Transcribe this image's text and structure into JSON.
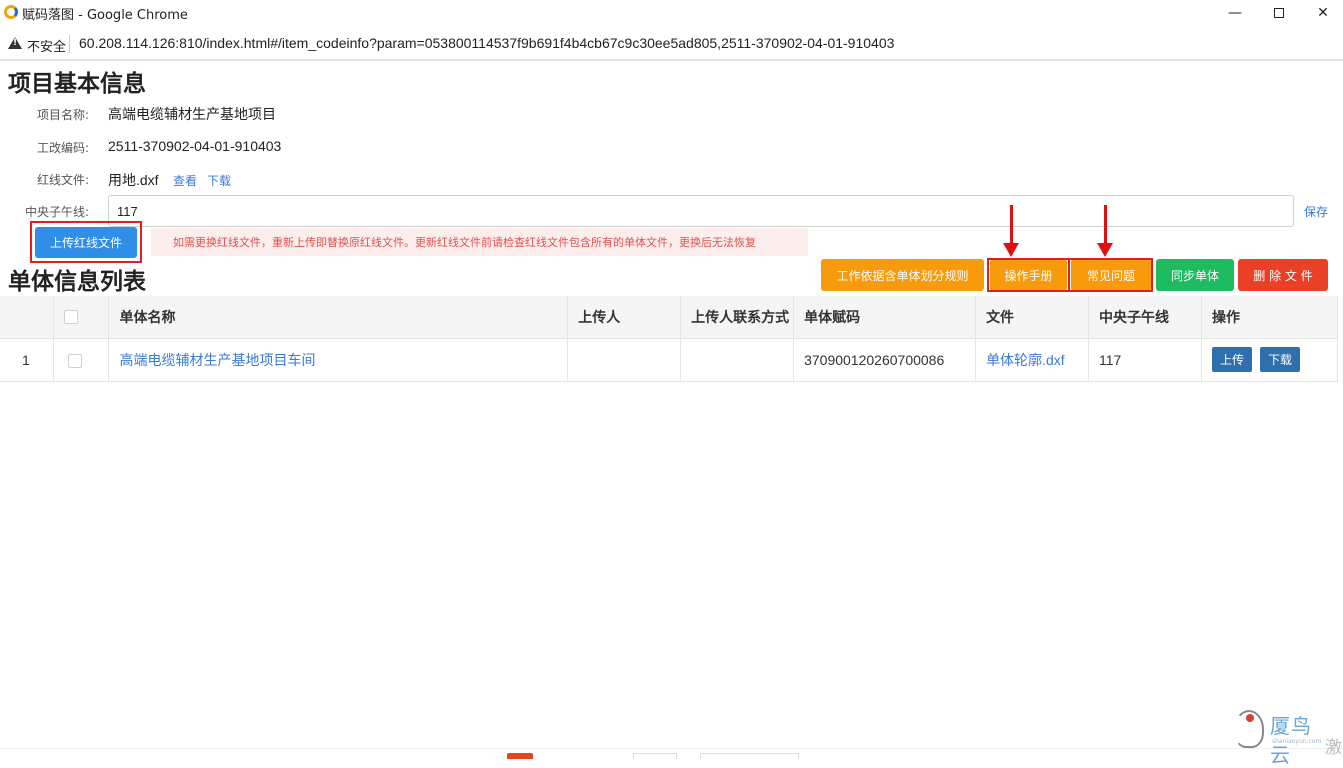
{
  "window": {
    "title": "赋码落图 - Google Chrome",
    "minimize": "—",
    "close": "✕"
  },
  "address": {
    "security": "不安全",
    "url": "60.208.114.126:810/index.html#/item_codeinfo?param=053800114537f9b691f4b4cb67c9c30ee5ad805,2511-370902-04-01-910403"
  },
  "project": {
    "heading": "项目基本信息",
    "name_label": "项目名称:",
    "name_value": "高端电缆辅材生产基地项目",
    "code_label": "工改编码:",
    "code_value": "2511-370902-04-01-910403",
    "redline_label": "红线文件:",
    "redline_file": "用地.dxf",
    "view_link": "查看",
    "download_link": "下载",
    "meridian_label": "中央子午线:",
    "meridian_value": "117",
    "save_link": "保存",
    "upload_button": "上传红线文件",
    "notice": "如需更换红线文件，重新上传即替换原红线文件。更新红线文件前请检查红线文件包含所有的单体文件，更换后无法恢复"
  },
  "units": {
    "heading": "单体信息列表",
    "buttons": {
      "rules": "工作依据含单体划分规则",
      "manual": "操作手册",
      "faq": "常见问题",
      "sync": "同步单体",
      "delete": "删 除 文 件"
    },
    "columns": [
      "",
      "",
      "单体名称",
      "上传人",
      "上传人联系方式",
      "单体赋码",
      "文件",
      "中央子午线",
      "操作"
    ],
    "rows": [
      {
        "index": "1",
        "name": "高端电缆辅材生产基地项目车间",
        "uploader": "",
        "contact": "",
        "code": "370900120260700086",
        "file": "单体轮廓.dxf",
        "meridian": "117",
        "upload": "上传",
        "download": "下载"
      }
    ]
  },
  "watermark": {
    "brand": "厦鸟云",
    "domain": "shaniaoyun.com",
    "edge": "激"
  },
  "colors": {
    "primary": "#2f8fe8",
    "orange": "#f79a0c",
    "green": "#1fbb61",
    "red": "#ea4126",
    "link": "#3a7bd5",
    "annotation": "#e02020"
  }
}
